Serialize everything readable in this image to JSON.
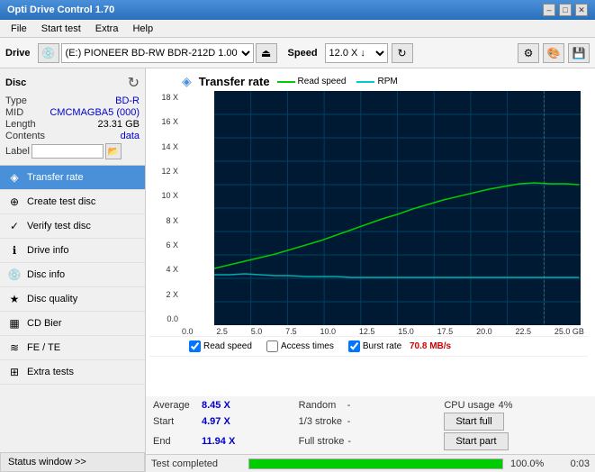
{
  "titleBar": {
    "title": "Opti Drive Control 1.70",
    "minimizeBtn": "–",
    "maximizeBtn": "□",
    "closeBtn": "✕"
  },
  "menuBar": {
    "items": [
      "File",
      "Start test",
      "Extra",
      "Help"
    ]
  },
  "driveToolbar": {
    "driveLabel": "Drive",
    "driveValue": "(E:)  PIONEER BD-RW   BDR-212D 1.00",
    "speedLabel": "Speed",
    "speedValue": "12.0 X ↓"
  },
  "disc": {
    "title": "Disc",
    "typeLabel": "Type",
    "typeValue": "BD-R",
    "midLabel": "MID",
    "midValue": "CMCMAGBA5 (000)",
    "lengthLabel": "Length",
    "lengthValue": "23.31 GB",
    "contentsLabel": "Contents",
    "contentsValue": "data",
    "labelLabel": "Label",
    "labelPlaceholder": ""
  },
  "navItems": [
    {
      "id": "transfer-rate",
      "label": "Transfer rate",
      "icon": "◈",
      "active": true
    },
    {
      "id": "create-test-disc",
      "label": "Create test disc",
      "icon": "⊕",
      "active": false
    },
    {
      "id": "verify-test-disc",
      "label": "Verify test disc",
      "icon": "✓",
      "active": false
    },
    {
      "id": "drive-info",
      "label": "Drive info",
      "icon": "ℹ",
      "active": false
    },
    {
      "id": "disc-info",
      "label": "Disc info",
      "icon": "💿",
      "active": false
    },
    {
      "id": "disc-quality",
      "label": "Disc quality",
      "icon": "★",
      "active": false
    },
    {
      "id": "cd-bier",
      "label": "CD Bier",
      "icon": "▦",
      "active": false
    },
    {
      "id": "fe-te",
      "label": "FE / TE",
      "icon": "≋",
      "active": false
    },
    {
      "id": "extra-tests",
      "label": "Extra tests",
      "icon": "⊞",
      "active": false
    }
  ],
  "statusWindowBtn": "Status window >>",
  "chart": {
    "title": "Transfer rate",
    "legend": {
      "readSpeedLabel": "Read speed",
      "rpmLabel": "RPM"
    },
    "yLabels": [
      "18 X",
      "16 X",
      "14 X",
      "12 X",
      "10 X",
      "8 X",
      "6 X",
      "4 X",
      "2 X",
      "0.0"
    ],
    "xLabels": [
      "0.0",
      "2.5",
      "5.0",
      "7.5",
      "10.0",
      "12.5",
      "15.0",
      "17.5",
      "20.0",
      "22.5",
      "25.0 GB"
    ]
  },
  "chartControls": {
    "readSpeedLabel": "Read speed",
    "accessTimesLabel": "Access times",
    "burstRateLabel": "Burst rate",
    "burstRateValue": "70.8 MB/s"
  },
  "stats": {
    "averageLabel": "Average",
    "averageValue": "8.45 X",
    "randomLabel": "Random",
    "randomValue": "-",
    "cpuUsageLabel": "CPU usage",
    "cpuUsageValue": "4%",
    "startLabel": "Start",
    "startValue": "4.97 X",
    "strokeLabel": "1/3 stroke",
    "strokeValue": "-",
    "startFullLabel": "Start full",
    "endLabel": "End",
    "endValue": "11.94 X",
    "fullStrokeLabel": "Full stroke",
    "fullStrokeValue": "-",
    "startPartLabel": "Start part"
  },
  "statusBar": {
    "text": "Test completed",
    "progress": 100,
    "progressLabel": "100.0%",
    "time": "0:03"
  }
}
